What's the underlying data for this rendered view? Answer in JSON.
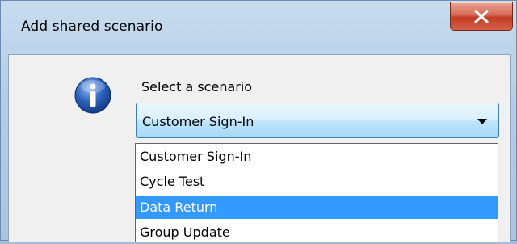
{
  "window": {
    "title": "Add shared scenario",
    "close_icon": "close-icon"
  },
  "dialog": {
    "icon": "information-icon",
    "prompt": "Select a scenario",
    "combo": {
      "value": "Customer Sign-In",
      "arrow_icon": "dropdown-arrow-icon"
    },
    "options": [
      {
        "label": "Customer Sign-In",
        "selected": false
      },
      {
        "label": "Cycle Test",
        "selected": false
      },
      {
        "label": "Data Return",
        "selected": true
      },
      {
        "label": "Group Update",
        "selected": false
      }
    ]
  },
  "colors": {
    "selection": "#3399ff",
    "close_button": "#c43c23"
  }
}
